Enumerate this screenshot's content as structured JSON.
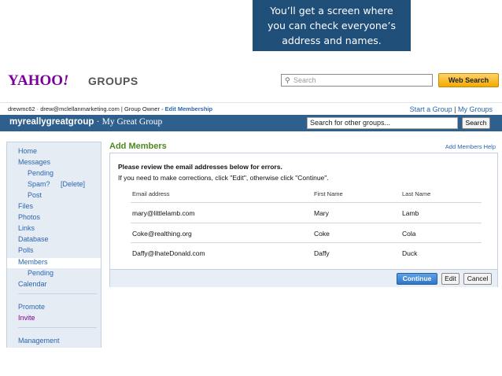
{
  "callout": {
    "line1": "You’ll get a screen where",
    "line2": "you can check everyone’s",
    "line3": "address and names."
  },
  "header": {
    "logo_text": "YAHOO",
    "logo_excl": "!",
    "logo_suffix": "GROUPS",
    "search_placeholder": "Search",
    "web_search_label": "Web Search"
  },
  "user_bar": {
    "info": "drewmc62 · drew@mclellanmarketing.com | Group Owner",
    "edit_membership": "- Edit Membership",
    "start_group": "Start a Group",
    "separator": "|",
    "my_groups": "My Groups"
  },
  "group_bar": {
    "group_id": "myreallygreatgroup",
    "separator": "·",
    "group_name": "My Great Group",
    "search_value": "Search for other groups...",
    "search_button": "Search"
  },
  "sidebar": {
    "home": "Home",
    "messages": "Messages",
    "pending": "Pending",
    "spam": "Spam?",
    "delete": "[Delete]",
    "post": "Post",
    "files": "Files",
    "photos": "Photos",
    "links": "Links",
    "database": "Database",
    "polls": "Polls",
    "members": "Members",
    "members_pending": "Pending",
    "calendar": "Calendar",
    "promote": "Promote",
    "invite": "Invite",
    "management": "Management"
  },
  "main": {
    "title": "Add Members",
    "help_link": "Add Members Help",
    "review_text": "Please review the email addresses below for errors.",
    "instruction_text": "If you need to make corrections, click \"Edit\", otherwise click \"Continue\".",
    "columns": {
      "email": "Email address",
      "first": "First Name",
      "last": "Last Name"
    },
    "rows": [
      {
        "email": "mary@littlelamb.com",
        "first": "Mary",
        "last": "Lamb"
      },
      {
        "email": "Coke@realthing.org",
        "first": "Coke",
        "last": "Cola"
      },
      {
        "email": "Daffy@IhateDonald.com",
        "first": "Daffy",
        "last": "Duck"
      }
    ],
    "continue_label": "Continue",
    "edit_label": "Edit",
    "cancel_label": "Cancel"
  }
}
